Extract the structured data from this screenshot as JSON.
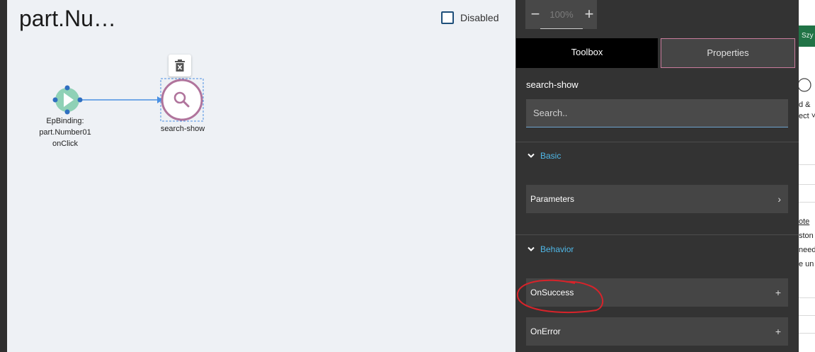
{
  "canvas": {
    "title": "part.Nu…",
    "disabled_label": "Disabled",
    "nodes": [
      {
        "lines": [
          "EpBinding:",
          "part.Number01",
          "onClick"
        ],
        "icon": "play-icon",
        "color": "#8fd1b6"
      },
      {
        "lines": [
          "search-show"
        ],
        "icon": "search-icon",
        "color": "#b0749c"
      }
    ]
  },
  "panel": {
    "zoom": {
      "minus": "−",
      "value": "100%",
      "plus": "+"
    },
    "tabs": {
      "toolbox": "Toolbox",
      "properties": "Properties"
    },
    "selected_node": "search-show",
    "search_placeholder": "Search..",
    "sections": {
      "basic": {
        "label": "Basic",
        "rows": [
          {
            "label": "Parameters",
            "icon": "chevron-right-icon"
          }
        ]
      },
      "behavior": {
        "label": "Behavior",
        "rows": [
          {
            "label": "OnSuccess",
            "icon": "plus-icon"
          },
          {
            "label": "OnError",
            "icon": "plus-icon"
          }
        ]
      }
    }
  },
  "background_app": {
    "ribbon_text": "Szy",
    "snippets": [
      "d &",
      "ect ˅",
      "ote",
      "ston",
      "need",
      "e un"
    ]
  },
  "colors": {
    "accent": "#4fb8e8",
    "annotation": "#d8232a",
    "tab_active_bg": "#000000",
    "tab_border": "#c97c9c"
  }
}
